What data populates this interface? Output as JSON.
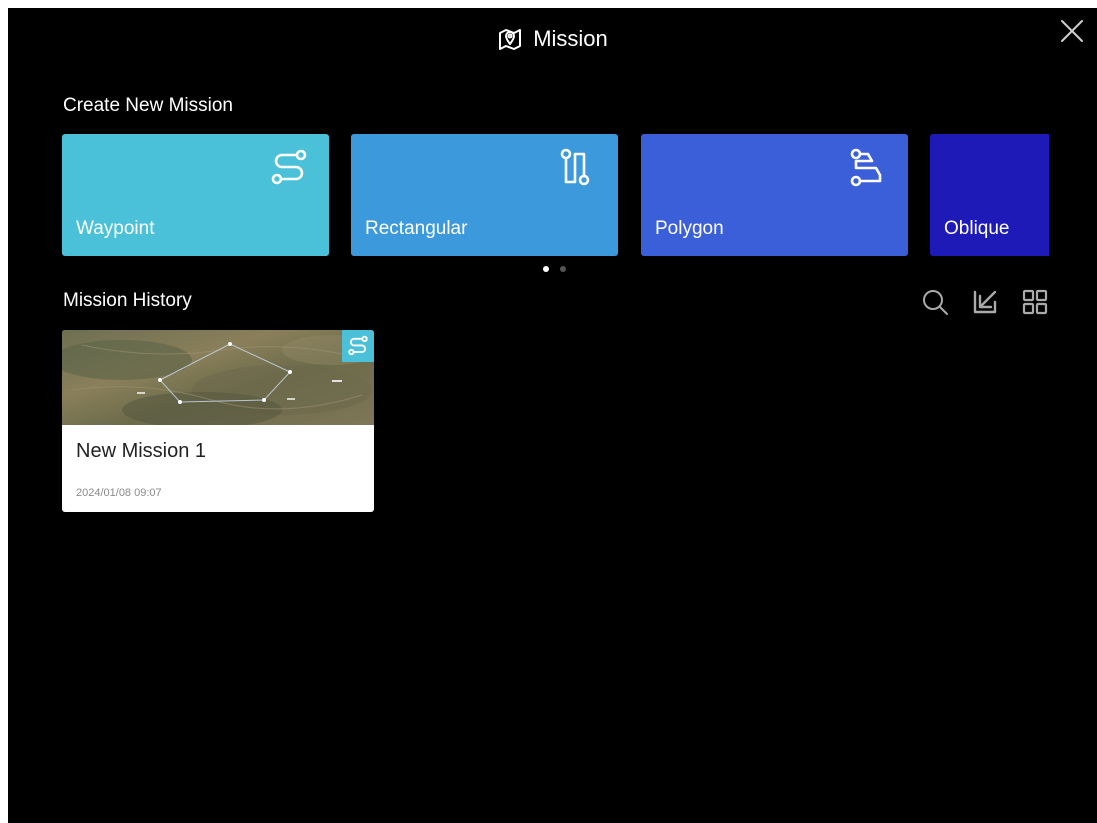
{
  "header": {
    "title": "Mission",
    "title_icon": "map-pin-icon",
    "close_icon": "close-icon"
  },
  "create_section": {
    "title": "Create New Mission",
    "cards": [
      {
        "label": "Waypoint",
        "icon": "waypoint-route-icon",
        "color": "#4bc0d9"
      },
      {
        "label": "Rectangular",
        "icon": "rectangular-route-icon",
        "color": "#3c99db"
      },
      {
        "label": "Polygon",
        "icon": "polygon-route-icon",
        "color": "#3a5fd8"
      },
      {
        "label": "Oblique",
        "icon": "oblique-route-icon",
        "color": "#1e1ab8"
      }
    ],
    "pagination": {
      "pages": 2,
      "active": 0
    }
  },
  "history_section": {
    "title": "Mission History",
    "tools": [
      "search-icon",
      "import-icon",
      "grid-view-icon"
    ],
    "items": [
      {
        "name": "New Mission 1",
        "date": "2024/01/08 09:07",
        "badge_icon": "waypoint-route-icon",
        "badge_color": "#4bc0d9"
      }
    ]
  }
}
